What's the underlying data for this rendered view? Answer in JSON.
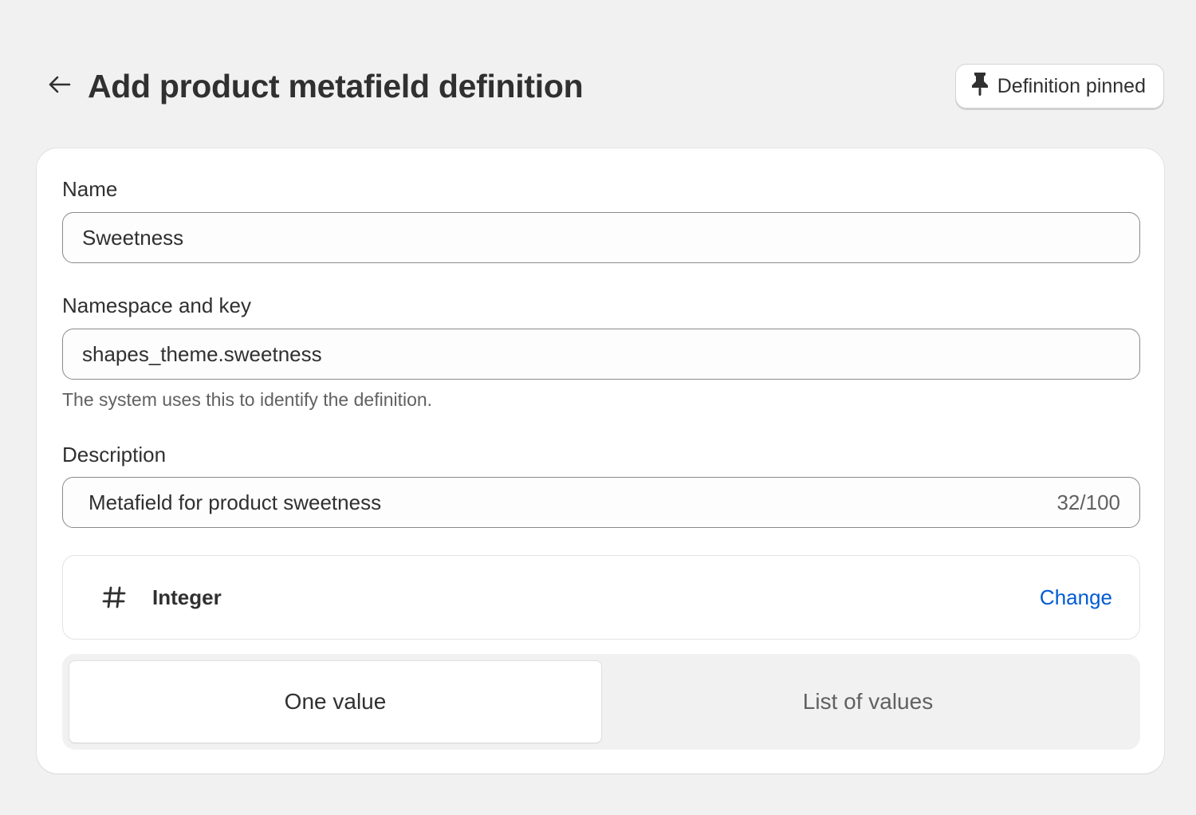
{
  "header": {
    "title": "Add product metafield definition",
    "pin_button_label": "Definition pinned",
    "back_icon": "arrow-left-icon",
    "pin_icon": "pin-icon"
  },
  "form": {
    "name": {
      "label": "Name",
      "value": "Sweetness"
    },
    "namespace_key": {
      "label": "Namespace and key",
      "value": "shapes_theme.sweetness",
      "help_text": "The system uses this to identify the definition."
    },
    "description": {
      "label": "Description",
      "value": "Metafield for product sweetness",
      "counter": "32/100"
    },
    "type": {
      "icon": "hash-icon",
      "name": "Integer",
      "change_label": "Change"
    },
    "value_mode": {
      "options": [
        "One value",
        "List of values"
      ],
      "selected": "One value"
    }
  },
  "colors": {
    "background": "#f1f1f1",
    "card": "#ffffff",
    "link": "#005bd3",
    "text": "#303030",
    "muted_text": "#616161"
  }
}
